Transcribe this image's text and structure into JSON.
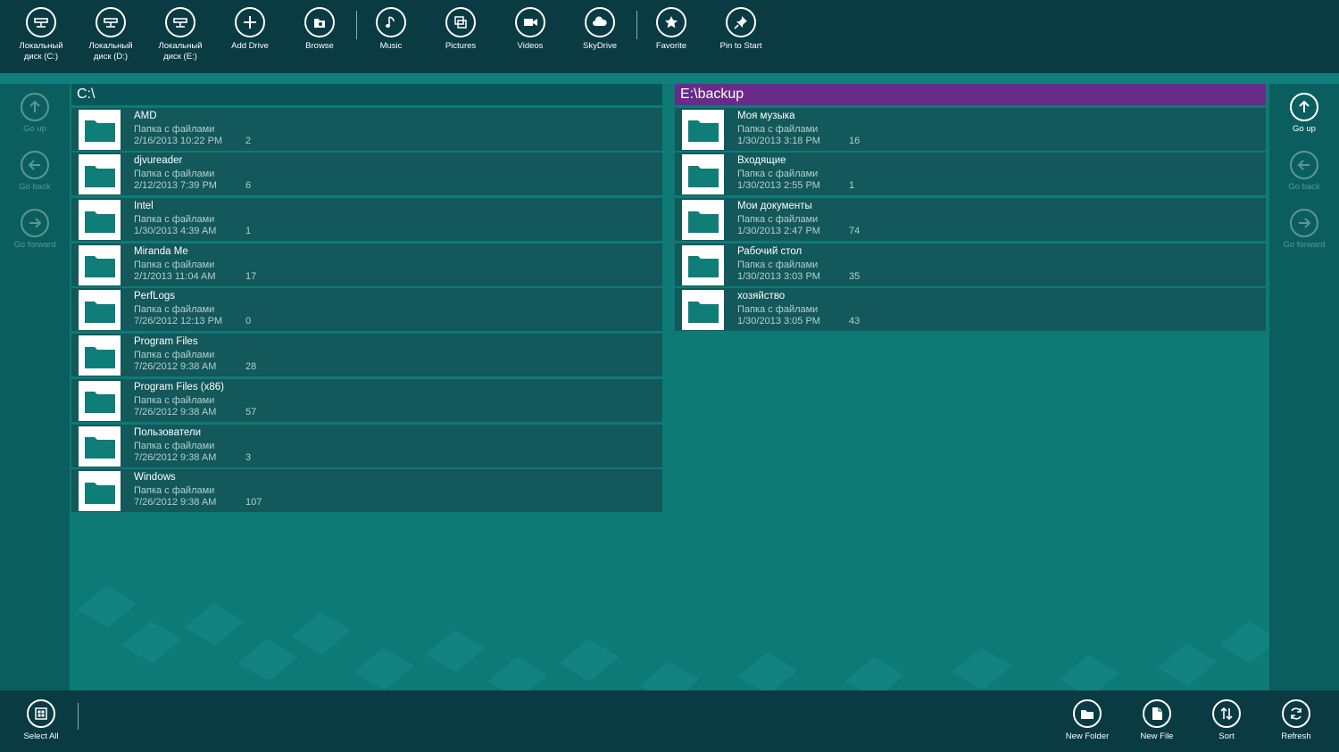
{
  "topbar": {
    "buttons": [
      {
        "label": "Локальный\nдиск (C:)",
        "icon": "drive-icon"
      },
      {
        "label": "Локальный\nдиск (D:)",
        "icon": "drive-icon"
      },
      {
        "label": "Локальный\nдиск (E:)",
        "icon": "drive-icon"
      },
      {
        "label": "Add Drive",
        "icon": "plus-icon"
      },
      {
        "label": "Browse",
        "icon": "browse-icon"
      },
      {
        "label": "Music",
        "icon": "music-icon"
      },
      {
        "label": "Pictures",
        "icon": "pictures-icon"
      },
      {
        "label": "Videos",
        "icon": "video-icon"
      },
      {
        "label": "SkyDrive",
        "icon": "cloud-icon"
      },
      {
        "label": "Favorite",
        "icon": "star-icon"
      },
      {
        "label": "Pin to Start",
        "icon": "pin-icon"
      }
    ]
  },
  "left_nav": {
    "go_up": "Go up",
    "go_back": "Go back",
    "go_forward": "Go forward"
  },
  "right_nav": {
    "go_up": "Go up",
    "go_back": "Go back",
    "go_forward": "Go forward"
  },
  "left_pane": {
    "path": "C:\\",
    "items": [
      {
        "name": "AMD",
        "type": "Папка с файлами",
        "date": "2/16/2013 10:22 PM",
        "count": "2"
      },
      {
        "name": "djvureader",
        "type": "Папка с файлами",
        "date": "2/12/2013 7:39 PM",
        "count": "6"
      },
      {
        "name": "Intel",
        "type": "Папка с файлами",
        "date": "1/30/2013 4:39 AM",
        "count": "1"
      },
      {
        "name": "Miranda Me",
        "type": "Папка с файлами",
        "date": "2/1/2013 11:04 AM",
        "count": "17"
      },
      {
        "name": "PerfLogs",
        "type": "Папка с файлами",
        "date": "7/26/2012 12:13 PM",
        "count": "0"
      },
      {
        "name": "Program Files",
        "type": "Папка с файлами",
        "date": "7/26/2012 9:38 AM",
        "count": "28"
      },
      {
        "name": "Program Files (x86)",
        "type": "Папка с файлами",
        "date": "7/26/2012 9:38 AM",
        "count": "57"
      },
      {
        "name": "Пользователи",
        "type": "Папка с файлами",
        "date": "7/26/2012 9:38 AM",
        "count": "3"
      },
      {
        "name": "Windows",
        "type": "Папка с файлами",
        "date": "7/26/2012 9:38 AM",
        "count": "107"
      }
    ]
  },
  "right_pane": {
    "path": "E:\\backup",
    "items": [
      {
        "name": "Моя музыка",
        "type": "Папка с файлами",
        "date": "1/30/2013 3:18 PM",
        "count": "16"
      },
      {
        "name": "Входящие",
        "type": "Папка с файлами",
        "date": "1/30/2013 2:55 PM",
        "count": "1"
      },
      {
        "name": "Мои документы",
        "type": "Папка с файлами",
        "date": "1/30/2013 2:47 PM",
        "count": "74"
      },
      {
        "name": "Рабочий стол",
        "type": "Папка с файлами",
        "date": "1/30/2013 3:03 PM",
        "count": "35"
      },
      {
        "name": "хозяйство",
        "type": "Папка с файлами",
        "date": "1/30/2013 3:05 PM",
        "count": "43"
      }
    ]
  },
  "bottombar": {
    "select_all": "Select All",
    "new_folder": "New Folder",
    "new_file": "New File",
    "sort": "Sort",
    "refresh": "Refresh"
  },
  "colors": {
    "bar": "#0a3a42",
    "background": "#0e7a76",
    "side": "#0b5e5e",
    "item": "#13585a",
    "active_path": "#6a2a8a",
    "folder": "#0f7d78"
  }
}
